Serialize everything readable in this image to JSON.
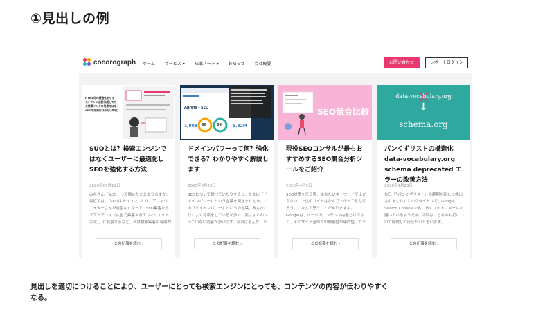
{
  "slide": {
    "title": "①見出しの例",
    "caption": "見出しを適切につけることにより、ユーザーにとっても検索エンジンにとっても、コンテンツの内容が伝わりやすくなる。"
  },
  "header": {
    "logo_text": "cocorograph",
    "nav": [
      "ホーム",
      "サービス ▾",
      "知識ノート ▾",
      "お知らせ",
      "会社概要"
    ],
    "inquiry_button": "お問い合わせ",
    "login_button": "レポートログイン"
  },
  "cards": [
    {
      "title": "SUOとは？検索エンジンではなくユーザーに最適化しSEOを強化する方法",
      "date": "2020年07月19日",
      "excerpt": "みなさん「SUO」って聞いたことありますか。最近では、「SEOはオワコン」とか、アフィリエイターさんが絶望なくなって、SEO集客から「アドアフィ（広告で集客するアフィリエイト手法）」に転換するなど、自然検索集客の時期的",
      "more": "この記事を読む ›",
      "image_text": [
        "HTML化の構造化をせず",
        "コンテンツ自動作成しても",
        "大規模リンクの効果ではなく",
        "SEOの効果はほぼない時代。"
      ]
    },
    {
      "title": "ドメインパワーって何？強化できる？わかりやすく解説します",
      "date": "2020年6月29日",
      "excerpt": "SEOについて調べていたりすると、たまに「ドメインパワー」という言葉を聞きませんか。この「ドメインパワー」というの言葉、みんなわりとよく認識をしているが多く、実はよくわかっていない内容が多いです。今日はそんな「ドメインパワ",
      "more": "この記事を読む ›",
      "image_text": [
        "Ahrefs - SEO",
        "1,903",
        "96",
        "89",
        "5.82M"
      ]
    },
    {
      "title": "現役SEOコンサルが最もおすすめするSEO競合分析ツールをご紹介",
      "date": "2020年4月5日",
      "excerpt": "SEO対策を行う際、あなたいキーワードで上がらない、上位のサイトはなんで上がってるんだろう、、、なんて思うことがありますよ。Googleは、ページのコンテンツ内容だけでなく、そのサイト全体での網羅性や専門性、サイト内の",
      "more": "この記事を読む ›",
      "image_text": [
        "SEO競合比較"
      ]
    },
    {
      "title": "パンくずリストの構造化data-vocabulary.org schema deprecated エラーの改善方法",
      "date": "2020年1月23日",
      "excerpt": "先日「「パンくずリスト」の範囲が新たに検出されました」というタイトルで、Google Search Consoleから、多くサイトにメールが届いているようです。今回はこちらの対応について解説して行きたいと思います。",
      "more": "この記事を読む ›",
      "image_text": [
        "data-vocabulary.org",
        "↓",
        "schema.org"
      ]
    }
  ],
  "colors": {
    "accent_pink": "#e8386d",
    "card4_teal": "#2fa8a0",
    "card3_pink": "#f7b4d6",
    "card2_navy": "#16324f"
  }
}
